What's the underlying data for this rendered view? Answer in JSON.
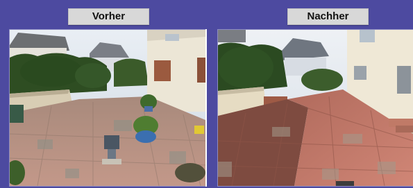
{
  "labels": {
    "before": "Vorher",
    "after": "Nachher"
  },
  "colors": {
    "background": "#4d4aa0",
    "label_bg": "#d8d8d8"
  }
}
